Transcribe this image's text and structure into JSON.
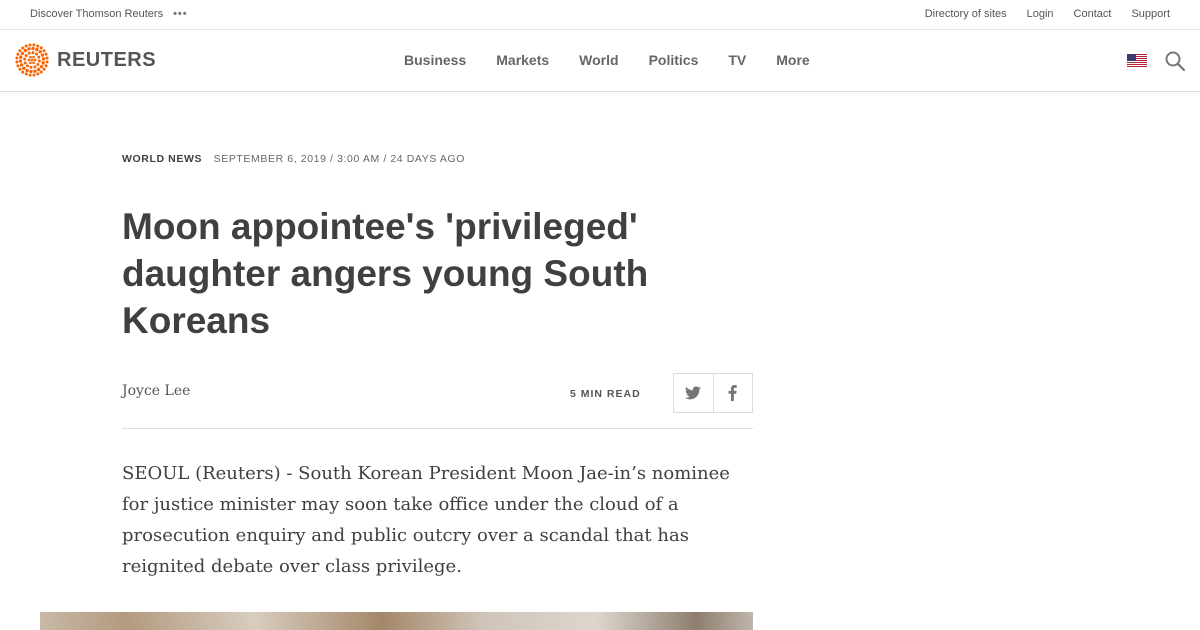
{
  "utility": {
    "discover_label": "Discover Thomson Reuters",
    "more_dots": "•••",
    "links": [
      "Directory of sites",
      "Login",
      "Contact",
      "Support"
    ]
  },
  "header": {
    "logo_text": "REUTERS",
    "nav": [
      "Business",
      "Markets",
      "World",
      "Politics",
      "TV",
      "More"
    ],
    "brand_color": "#fa6400"
  },
  "article": {
    "section": "WORLD NEWS",
    "date": "SEPTEMBER 6, 2019 / 3:00 AM / 24 DAYS AGO",
    "headline": "Moon appointee's 'privileged' daughter angers young South Koreans",
    "author": "Joyce Lee",
    "read_time": "5 MIN READ",
    "body": "SEOUL (Reuters) - South Korean President Moon Jae-in’s nominee for justice minister may soon take office under the cloud of a prosecution enquiry and public outcry over a scandal that has reignited debate over class privilege."
  },
  "icons": {
    "logo": "reuters-dot-logo-icon",
    "flag": "us-flag-icon",
    "search": "search-icon",
    "twitter": "twitter-icon",
    "facebook": "facebook-icon"
  }
}
